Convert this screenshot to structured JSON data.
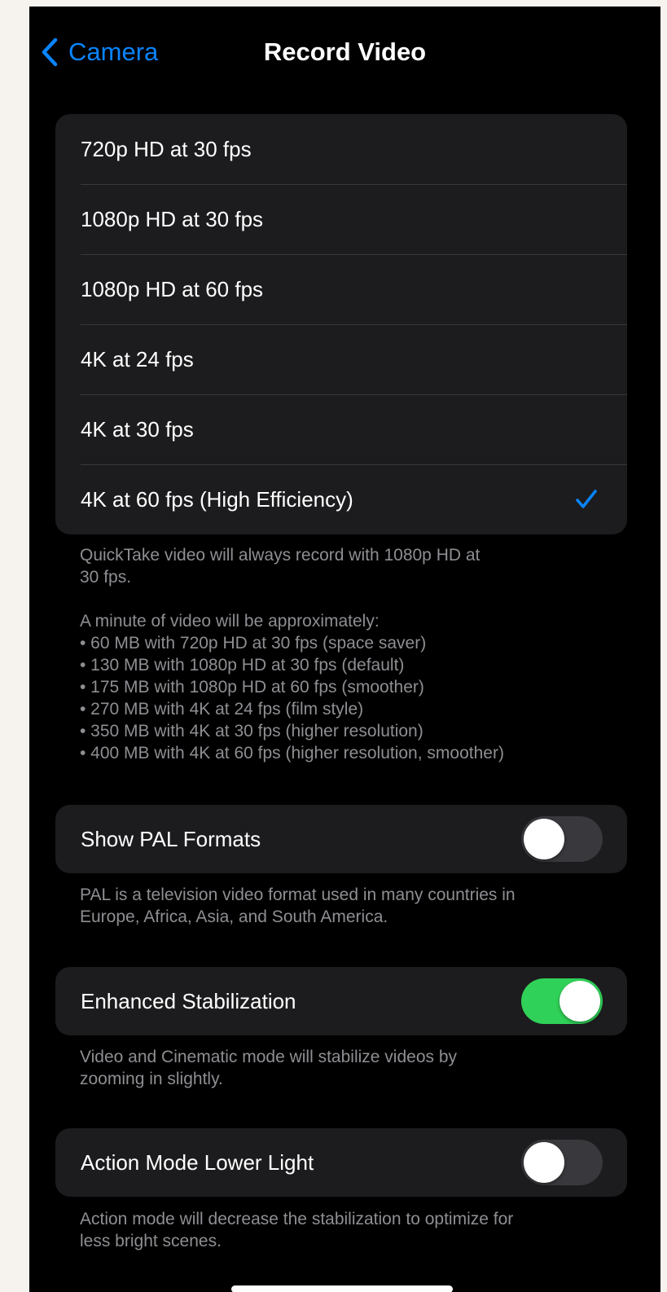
{
  "nav": {
    "back_label": "Camera",
    "title": "Record Video"
  },
  "formats": {
    "options": [
      {
        "label": "720p HD at 30 fps",
        "selected": false
      },
      {
        "label": "1080p HD at 30 fps",
        "selected": false
      },
      {
        "label": "1080p HD at 60 fps",
        "selected": false
      },
      {
        "label": "4K at 24 fps",
        "selected": false
      },
      {
        "label": "4K at 30 fps",
        "selected": false
      },
      {
        "label": "4K at 60 fps (High Efficiency)",
        "selected": true
      }
    ],
    "footer_quicktake": [
      "QuickTake video will always record with 1080p HD at",
      "30 fps."
    ],
    "footer_sizes_intro": "A minute of video will be approximately:",
    "footer_sizes": [
      "• 60 MB with 720p HD at 30 fps (space saver)",
      "• 130 MB with 1080p HD at 30 fps (default)",
      "• 175 MB with 1080p HD at 60 fps (smoother)",
      "• 270 MB with 4K at 24 fps (film style)",
      "• 350 MB with 4K at 30 fps (higher resolution)",
      "• 400 MB with 4K at 60 fps (higher resolution, smoother)"
    ]
  },
  "pal": {
    "label": "Show PAL Formats",
    "on": false,
    "footer": [
      "PAL is a television video format used in many countries in",
      "Europe, Africa, Asia, and South America."
    ]
  },
  "stabilization": {
    "label": "Enhanced Stabilization",
    "on": true,
    "footer": [
      "Video and Cinematic mode will stabilize videos by",
      "zooming in slightly."
    ]
  },
  "action_mode": {
    "label": "Action Mode Lower Light",
    "on": false,
    "footer": [
      "Action mode will decrease the stabilization to optimize for",
      "less bright scenes."
    ]
  },
  "colors": {
    "accent": "#0a84ff",
    "toggle_on": "#30d158",
    "toggle_off": "#39393d",
    "card": "#1c1c1e",
    "footnote": "#8e8e93"
  },
  "icons": {
    "back": "chevron-left-icon",
    "selected": "checkmark-icon"
  }
}
